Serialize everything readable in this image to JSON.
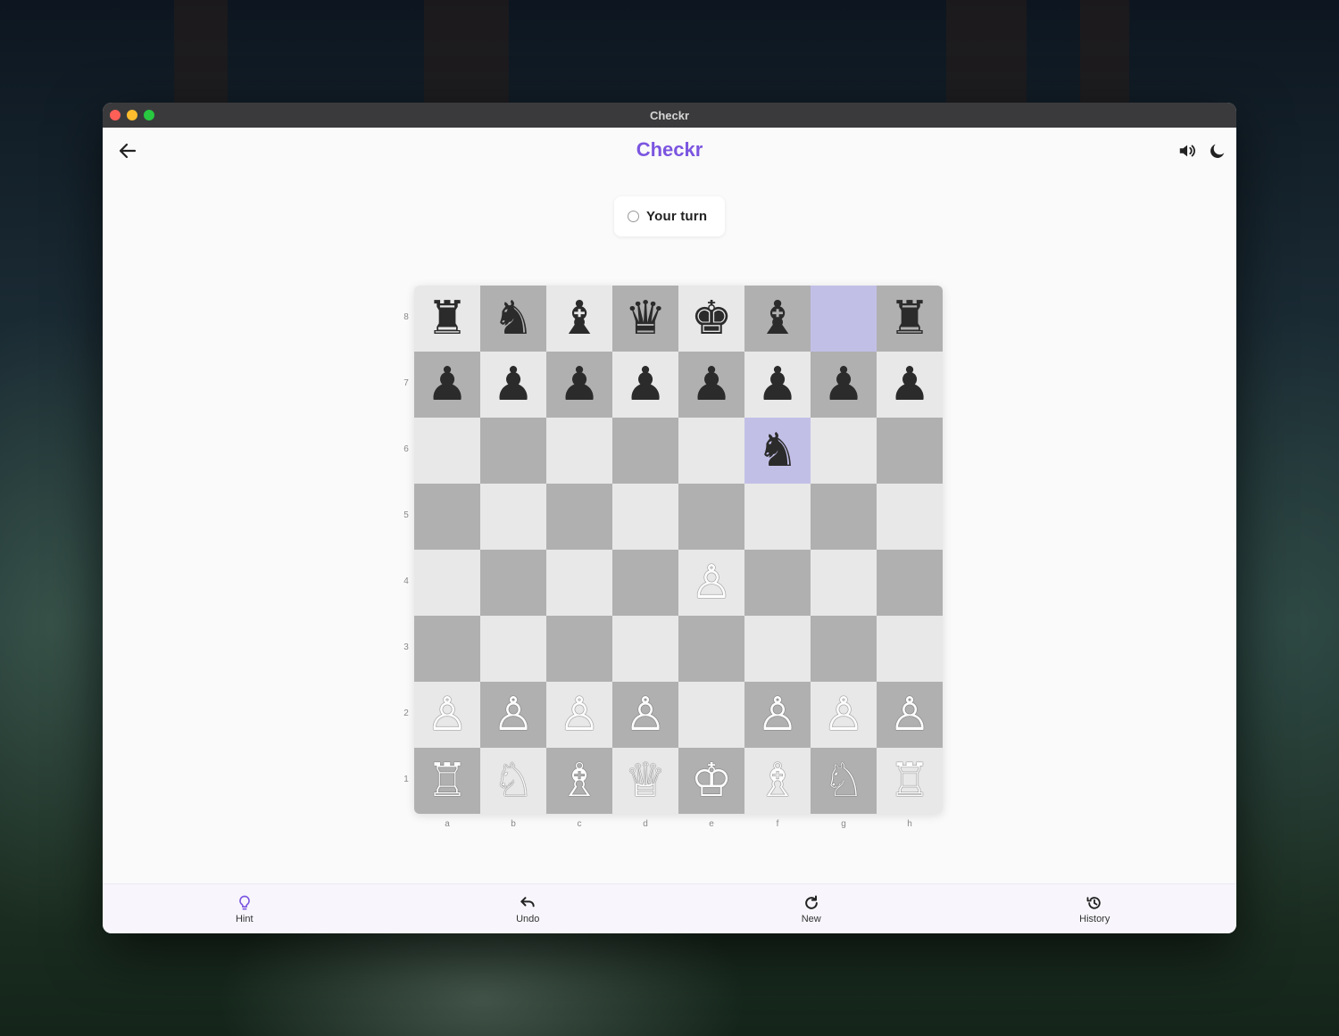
{
  "window": {
    "title": "Checkr"
  },
  "appbar": {
    "title": "Checkr",
    "back_icon": "arrow-left-icon",
    "sound_icon": "speaker-icon",
    "theme_icon": "moon-icon"
  },
  "status": {
    "turn_text": "Your turn"
  },
  "colors": {
    "accent": "#7b55e0",
    "light_square": "#e8e8e8",
    "dark_square": "#b0b0b0",
    "highlight": "#c2bfe7"
  },
  "board": {
    "ranks": [
      "8",
      "7",
      "6",
      "5",
      "4",
      "3",
      "2",
      "1"
    ],
    "files": [
      "a",
      "b",
      "c",
      "d",
      "e",
      "f",
      "g",
      "h"
    ],
    "highlighted": [
      "g8",
      "f6"
    ],
    "squares": [
      [
        "♜",
        "♞",
        "♝",
        "♛",
        "♚",
        "♝",
        "",
        "♜"
      ],
      [
        "♟",
        "♟",
        "♟",
        "♟",
        "♟",
        "♟",
        "♟",
        "♟"
      ],
      [
        "",
        "",
        "",
        "",
        "",
        "♞",
        "",
        ""
      ],
      [
        "",
        "",
        "",
        "",
        "",
        "",
        "",
        ""
      ],
      [
        "",
        "",
        "",
        "",
        "♙",
        "",
        "",
        ""
      ],
      [
        "",
        "",
        "",
        "",
        "",
        "",
        "",
        ""
      ],
      [
        "♙",
        "♙",
        "♙",
        "♙",
        "",
        "♙",
        "♙",
        "♙"
      ],
      [
        "♖",
        "♘",
        "♗",
        "♕",
        "♔",
        "♗",
        "♘",
        "♖"
      ]
    ]
  },
  "bottom_nav": [
    {
      "label": "Hint",
      "icon": "lightbulb-icon"
    },
    {
      "label": "Undo",
      "icon": "undo-icon"
    },
    {
      "label": "New",
      "icon": "refresh-icon"
    },
    {
      "label": "History",
      "icon": "history-icon"
    }
  ]
}
